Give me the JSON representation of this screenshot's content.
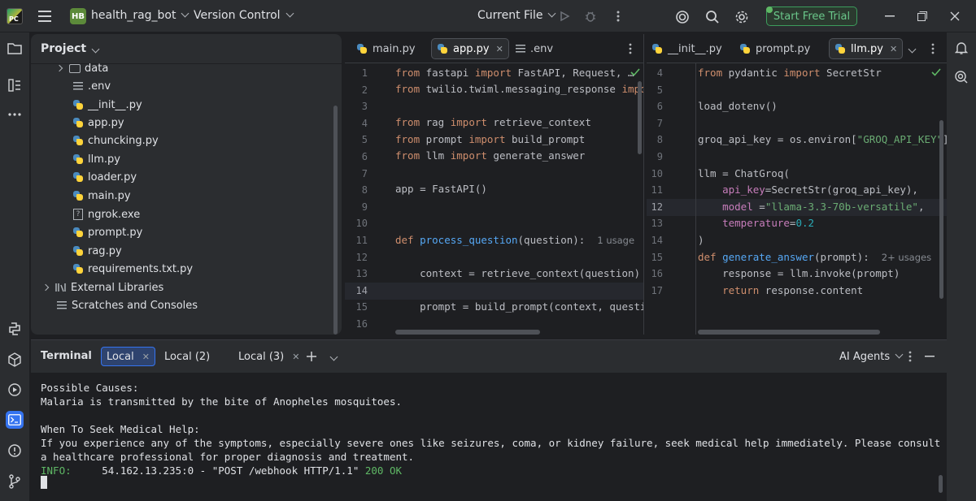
{
  "titlebar": {
    "logo_text": "PC",
    "project_badge": "HB",
    "project_name": "health_rag_bot",
    "vcs_label": "Version Control",
    "run_config": "Current File",
    "trial_button": "Start Free Trial"
  },
  "project_panel": {
    "title": "Project",
    "items": [
      {
        "label": "data",
        "type": "folder"
      },
      {
        "label": ".env",
        "type": "text"
      },
      {
        "label": "__init__.py",
        "type": "python"
      },
      {
        "label": "app.py",
        "type": "python"
      },
      {
        "label": "chuncking.py",
        "type": "python"
      },
      {
        "label": "llm.py",
        "type": "python"
      },
      {
        "label": "loader.py",
        "type": "python"
      },
      {
        "label": "main.py",
        "type": "python"
      },
      {
        "label": "ngrok.exe",
        "type": "unknown"
      },
      {
        "label": "prompt.py",
        "type": "python"
      },
      {
        "label": "rag.py",
        "type": "python"
      },
      {
        "label": "requirements.txt.py",
        "type": "python"
      },
      {
        "label": "External Libraries",
        "type": "library"
      },
      {
        "label": "Scratches and Consoles",
        "type": "scratch"
      }
    ]
  },
  "editor_left": {
    "tabs": [
      {
        "label": "main.py",
        "active": false
      },
      {
        "label": "app.py",
        "active": true
      },
      {
        "label": ".env",
        "active": false
      }
    ],
    "line_numbers": [
      "1",
      "2",
      "3",
      "4",
      "5",
      "6",
      "7",
      "8",
      "9",
      "10",
      "11",
      "12",
      "13",
      "14",
      "15",
      "16"
    ],
    "current_line": "14",
    "usage_hint": "1 usage"
  },
  "editor_right": {
    "tabs": [
      {
        "label": "__init__.py",
        "active": false
      },
      {
        "label": "prompt.py",
        "active": false
      },
      {
        "label": "llm.py",
        "active": true
      }
    ],
    "line_numbers": [
      "4",
      "5",
      "6",
      "7",
      "8",
      "9",
      "10",
      "11",
      "12",
      "13",
      "14",
      "15",
      "16",
      "17"
    ],
    "current_line": "12",
    "usage_hint": "2+ usages"
  },
  "terminal": {
    "title": "Terminal",
    "tabs": [
      "Local",
      "Local (2)",
      "Local (3)"
    ],
    "ai_agents": "AI Agents",
    "lines": [
      "Possible Causes:",
      "Malaria is transmitted by the bite of Anopheles mosquitoes.",
      "",
      "When To Seek Medical Help:",
      "If you experience any of the symptoms, especially severe ones like seizures, coma, or kidney failure, seek medical help immediately. Please consult",
      "a healthcare professional for proper diagnosis and treatment."
    ],
    "log_level": "INFO:",
    "log_rest": "     54.162.13.235:0 - \"POST /webhook HTTP/1.1\" ",
    "log_status": "200 OK"
  }
}
